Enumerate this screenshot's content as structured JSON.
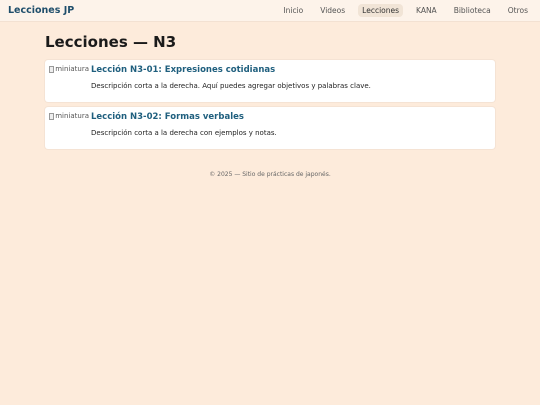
{
  "header": {
    "brand": "Lecciones JP",
    "nav": [
      {
        "label": "Inicio",
        "active": false
      },
      {
        "label": "Videos",
        "active": false
      },
      {
        "label": "Lecciones",
        "active": true
      },
      {
        "label": "KANA",
        "active": false
      },
      {
        "label": "Biblioteca",
        "active": false
      },
      {
        "label": "Otros",
        "active": false
      }
    ]
  },
  "main": {
    "title": "Lecciones — N3",
    "lessons": [
      {
        "thumb_alt": "miniatura",
        "title": "Lección N3-01: Expresiones cotidianas",
        "description": "Descripción corta a la derecha. Aquí puedes agregar objetivos y palabras clave."
      },
      {
        "thumb_alt": "miniatura",
        "title": "Lección N3-02: Formas verbales",
        "description": "Descripción corta a la derecha con ejemplos y notas."
      }
    ]
  },
  "footer": {
    "text": "© 2025 — Sitio de prácticas de japonés."
  },
  "colors": {
    "background": "#fdebdb",
    "header_background": "#fdf3ea",
    "brand": "#1f4e6b",
    "link": "#1f5f7e"
  }
}
